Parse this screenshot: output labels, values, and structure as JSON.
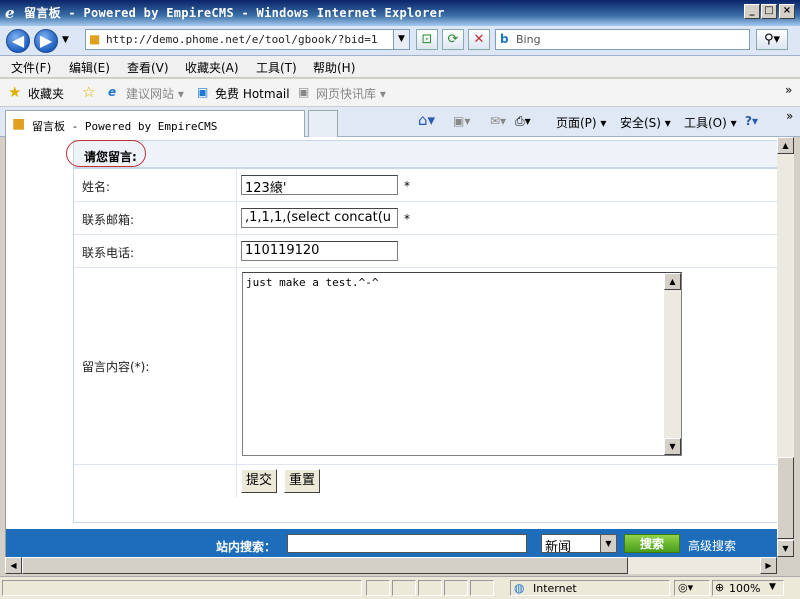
{
  "window": {
    "title": "留言板 - Powered by EmpireCMS - Windows Internet Explorer",
    "controls": [
      "_",
      "□",
      "×"
    ]
  },
  "address_bar": {
    "url": "http://demo.phome.net/e/tool/gbook/?bid=1",
    "search_placeholder": "Bing"
  },
  "menu": [
    "文件(F)",
    "编辑(E)",
    "查看(V)",
    "收藏夹(A)",
    "工具(T)",
    "帮助(H)"
  ],
  "favorites_bar": {
    "label": "收藏夹",
    "items": [
      "建议网站 ▾",
      "免费 Hotmail",
      "网页快讯库 ▾"
    ]
  },
  "tab": {
    "title": "留言板 - Powered by EmpireCMS"
  },
  "command_bar": {
    "page": "页面(P) ▾",
    "safety": "安全(S) ▾",
    "tools": "工具(O) ▾"
  },
  "form": {
    "header": "请您留言:",
    "name_label": "姓名:",
    "name_value": "123縗'",
    "email_label": "联系邮箱:",
    "email_value": ",1,1,1,(select concat(u",
    "phone_label": "联系电话:",
    "phone_value": "110119120",
    "content_label": "留言内容(*):",
    "content_value": "just make a test.^-^",
    "required_mark": "*",
    "submit_label": "提交",
    "reset_label": "重置"
  },
  "footer": {
    "search_label": "站内搜索：",
    "category_selected": "新闻",
    "search_button": "搜索",
    "advanced_link": "高级搜索"
  },
  "status_bar": {
    "zone": "Internet",
    "zoom": "100%"
  },
  "colors": {
    "title_bar": "#0a246a",
    "footer_bar": "#1e6dbb",
    "highlight_oval": "#c0303a",
    "search_button": "#5aa62a"
  }
}
